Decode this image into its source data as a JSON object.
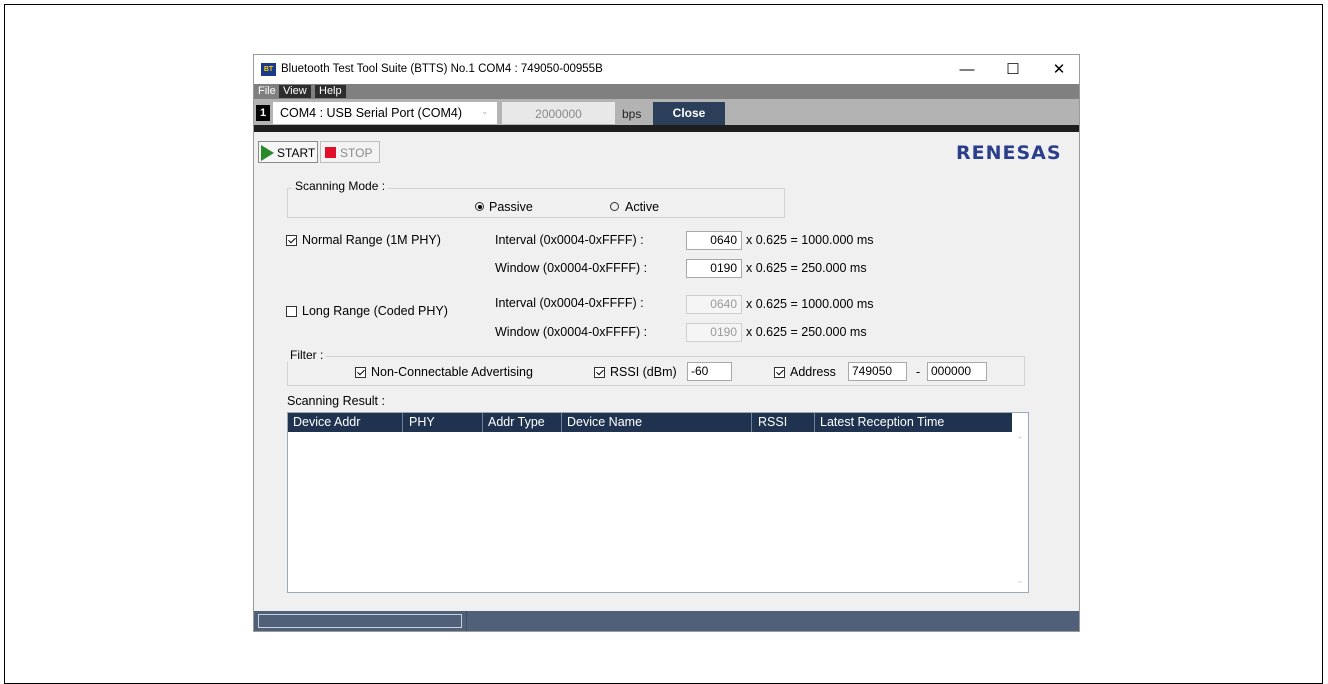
{
  "window": {
    "title": "Bluetooth Test Tool Suite (BTTS) No.1   COM4 : 749050-00955B",
    "app_icon_text": "BT",
    "minimize_glyph": "—",
    "maximize_glyph": "☐",
    "close_glyph": "✕"
  },
  "menu": {
    "file": "File",
    "view": "View",
    "help": "Help"
  },
  "portbar": {
    "port_number": "1",
    "port_name": "COM4 : USB Serial Port (COM4)",
    "chevron": "⌄",
    "baud_rate": "2000000",
    "baud_unit": "bps",
    "close_label": "Close"
  },
  "toolbar": {
    "start_label": "START",
    "stop_label": "STOP"
  },
  "brand": {
    "logo_text": "RENESAS"
  },
  "scanning_mode": {
    "title": "Scanning Mode :",
    "passive_label": "Passive",
    "active_label": "Active",
    "selected": "Passive"
  },
  "normal_range": {
    "label": "Normal Range (1M PHY)",
    "checked": true,
    "interval_label": "Interval (0x0004-0xFFFF) :",
    "interval_value": "0640",
    "interval_calc": "x 0.625 =   1000.000 ms",
    "window_label": "Window (0x0004-0xFFFF) :",
    "window_value": "0190",
    "window_calc": "x 0.625 =   250.000 ms"
  },
  "long_range": {
    "label": "Long Range (Coded PHY)",
    "checked": false,
    "interval_label": "Interval (0x0004-0xFFFF) :",
    "interval_value": "0640",
    "interval_calc": "x 0.625 =   1000.000 ms",
    "window_label": "Window (0x0004-0xFFFF) :",
    "window_value": "0190",
    "window_calc": "x 0.625 =   250.000 ms"
  },
  "filter": {
    "title": "Filter :",
    "non_connectable_label": "Non-Connectable Advertising",
    "rssi_label": "RSSI (dBm)",
    "rssi_value": "-60",
    "address_label": "Address",
    "address_start": "749050",
    "address_sep": "-",
    "address_end": "000000"
  },
  "results": {
    "title": "Scanning Result  :",
    "columns": [
      "Device Addr",
      "PHY",
      "Addr Type",
      "Device Name",
      "RSSI",
      "Latest Reception Time"
    ],
    "rows": [],
    "scroll_up": "⌃",
    "scroll_down": "⌄"
  },
  "colors": {
    "header_bg": "#1f3350",
    "close_button_bg": "#2b3e5a",
    "statusbar_bg": "#4f6078",
    "start_green": "#2a8a2a",
    "stop_red": "#e0102a",
    "logo_blue": "#2b3e8c"
  }
}
